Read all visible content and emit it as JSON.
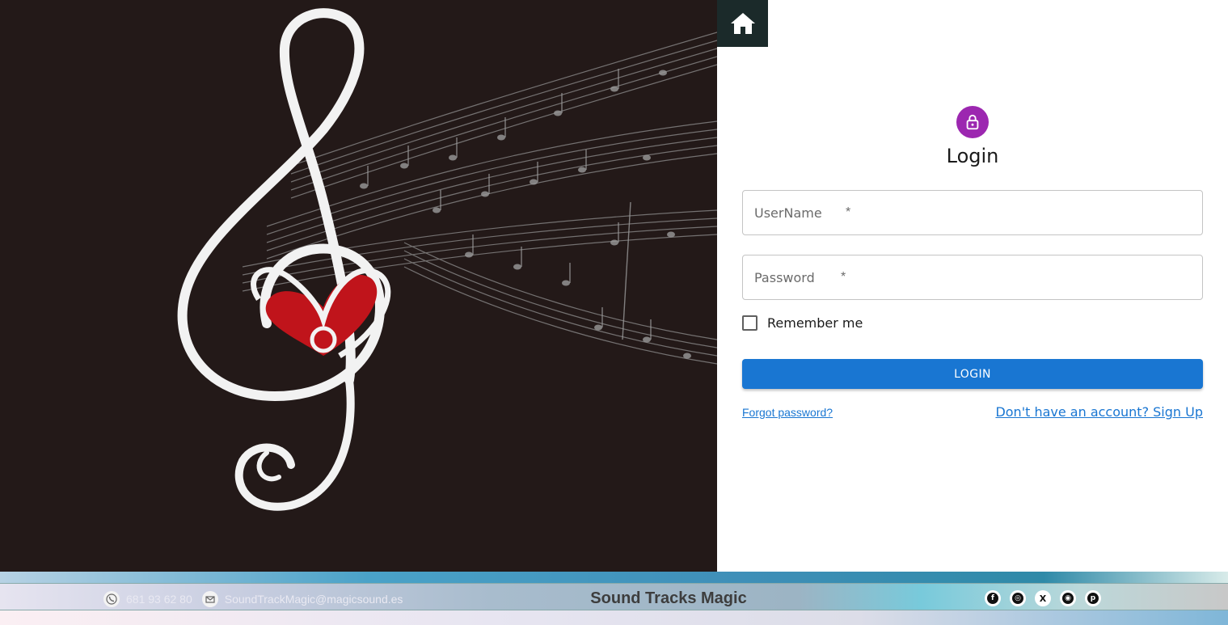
{
  "hero": {
    "alt": "treble clef with heart and music notes"
  },
  "nav": {
    "home_icon": "home-icon"
  },
  "form": {
    "avatar_icon": "lock-icon",
    "title": "Login",
    "username_placeholder": "UserName",
    "password_placeholder": "Password",
    "required_mark": "*",
    "remember_label": "Remember me",
    "login_label": "LOGIN",
    "forgot_label": "Forgot password?",
    "signup_label": "Don't have an account? Sign Up"
  },
  "footer": {
    "phone": "681 93 62 80",
    "email": "SoundTrackMagic@magicsound.es",
    "brand": "Sound Tracks Magic",
    "socials": [
      "facebook-icon",
      "whatsapp-icon",
      "x-icon",
      "instagram-icon",
      "pinterest-icon"
    ]
  },
  "colors": {
    "accent": "#1976d2",
    "avatar": "#9c27b0",
    "hero_bg": "#231918",
    "heart": "#c0141b"
  }
}
